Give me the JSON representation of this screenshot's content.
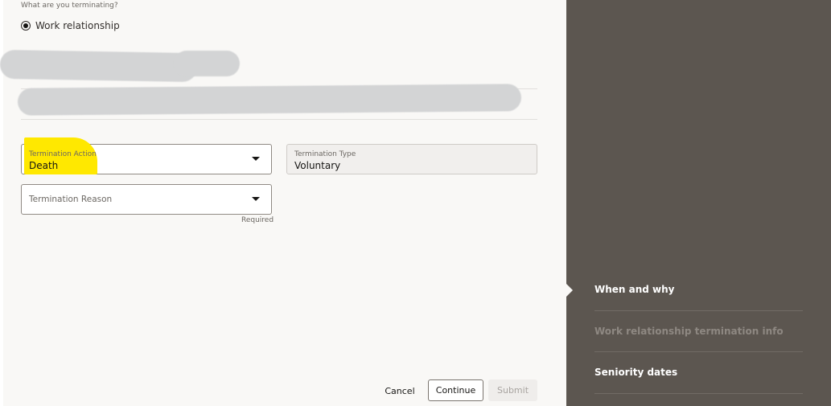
{
  "question": "What are you terminating?",
  "radio": {
    "label": "Work relationship",
    "selected": true
  },
  "fields": {
    "action": {
      "label": "Termination Action",
      "value": "Death"
    },
    "type": {
      "label": "Termination Type",
      "value": "Voluntary"
    },
    "reason": {
      "label": "Termination Reason",
      "helper": "Required"
    }
  },
  "buttons": {
    "cancel": "Cancel",
    "continue": "Continue",
    "submit": "Submit"
  },
  "steps": [
    {
      "label": "When and why",
      "state": "current"
    },
    {
      "label": "Work relationship termination info",
      "state": "disabled"
    },
    {
      "label": "Seniority dates",
      "state": "enabled"
    }
  ],
  "colors": {
    "sidebar": "#5c5650",
    "highlight": "#ffe800"
  }
}
